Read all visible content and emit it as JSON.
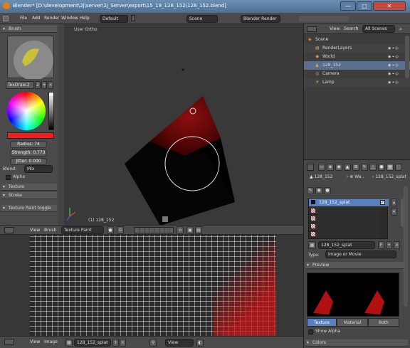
{
  "window": {
    "title": "Blender* [D:\\development\\2j\\server\\2j_Server\\export\\15_19_128_152\\128_152.blend]",
    "minimize": "—",
    "maximize": "□",
    "close": "✕"
  },
  "info_header": {
    "menus": [
      "File",
      "Add",
      "Render",
      "Window",
      "Help"
    ],
    "layout": "Default",
    "scene": "Scene",
    "engine": "Blender Render"
  },
  "brush": {
    "panel_title": "Brush",
    "name": "TexDraw.2",
    "users": "2",
    "radius_label": "Radius: 74",
    "strength_label": "Strength: 0.773",
    "jitter_label": "Jitter: 0.000",
    "blend_label": "Blend:",
    "blend_value": "Mix",
    "alpha_label": "Alpha",
    "color": "#ff1a1a"
  },
  "shelf_panels": {
    "texture": "Texture",
    "stroke": "Stroke",
    "texture_paint_toggle": "Texture Paint toggle"
  },
  "viewport": {
    "corner_label": "User Ortho",
    "object_label": "(1) 128_152"
  },
  "viewport_header": {
    "view": "View",
    "brush": "Brush",
    "mode": "Texture Paint"
  },
  "image_editor_header": {
    "view": "View",
    "image": "Image",
    "image_name": "128_152_splat",
    "view_right": "View"
  },
  "outliner": {
    "view": "View",
    "search": "Search",
    "filter": "All Scenes",
    "rows": [
      {
        "label": "Scene",
        "depth": 0
      },
      {
        "label": "RenderLayers",
        "depth": 1
      },
      {
        "label": "World",
        "depth": 1
      },
      {
        "label": "128_152",
        "depth": 1,
        "selected": true
      },
      {
        "label": "Camera",
        "depth": 1
      },
      {
        "label": "Lamp",
        "depth": 1
      }
    ]
  },
  "properties": {
    "breadcrumb_obj": "128_152",
    "breadcrumb_tex": "128_152_splat",
    "texture_slot_selected": "128_152_splat",
    "datablock_name": "128_152_splat",
    "type_label": "Type:",
    "type_value": "Image or Movie",
    "preview_label": "Preview",
    "preview_tabs": [
      "Texture",
      "Material",
      "Both"
    ],
    "show_alpha": "Show Alpha",
    "colors_label": "Colors"
  }
}
